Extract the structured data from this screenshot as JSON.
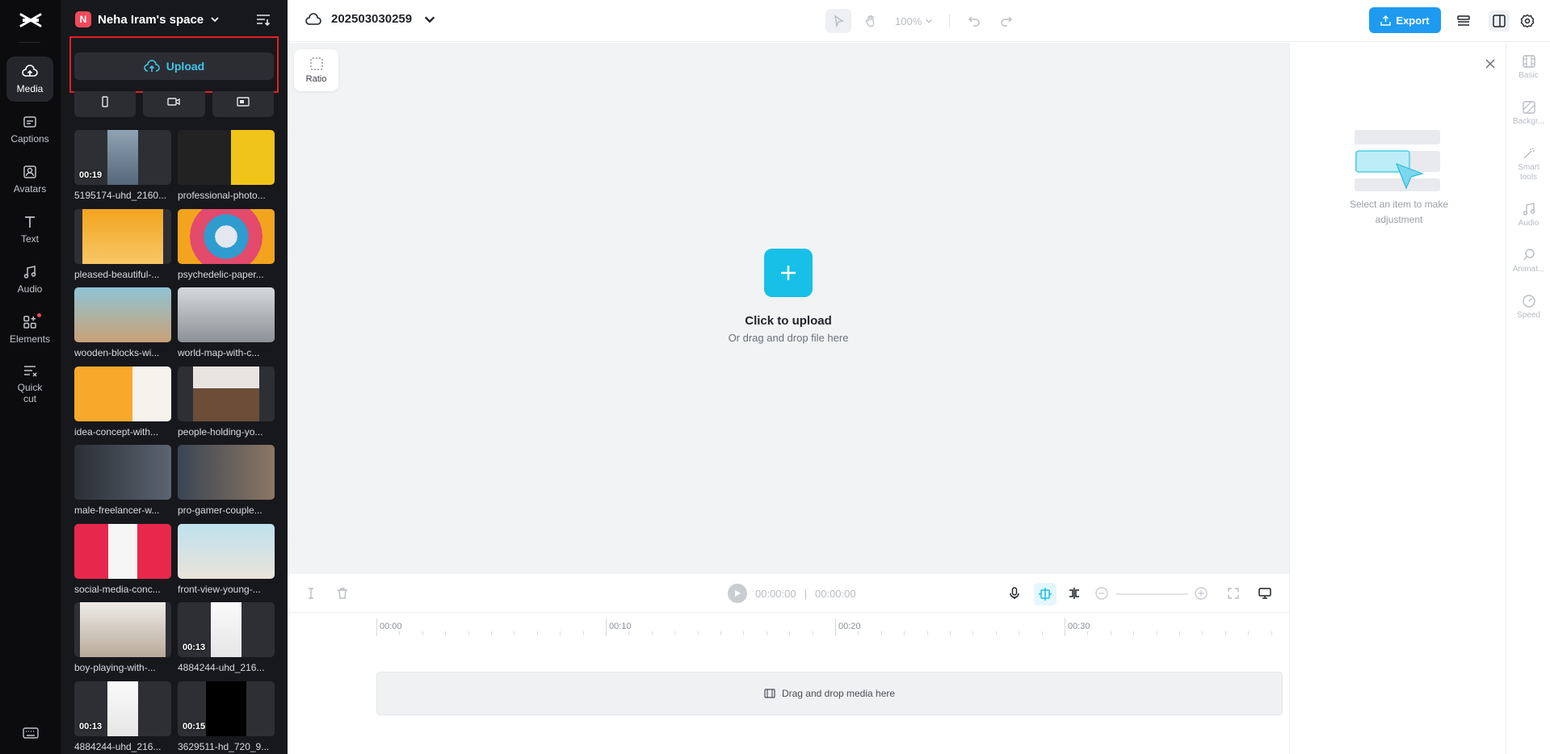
{
  "nav": {
    "items": [
      {
        "label": "Media",
        "icon": "cloud-upload-icon",
        "active": true
      },
      {
        "label": "Captions",
        "icon": "captions-icon"
      },
      {
        "label": "Avatars",
        "icon": "avatar-icon"
      },
      {
        "label": "Text",
        "icon": "text-icon"
      },
      {
        "label": "Audio",
        "icon": "music-note-icon"
      },
      {
        "label": "Elements",
        "icon": "elements-icon",
        "has_dot": true
      },
      {
        "label": "Quick cut",
        "icon": "scissors-icon"
      }
    ]
  },
  "workspace": {
    "initial": "N",
    "name": "Neha Iram's space"
  },
  "media": {
    "upload_label": "Upload",
    "items": [
      {
        "name": "5195174-uhd_2160...",
        "duration": "00:19"
      },
      {
        "name": "professional-photo...",
        "duration": ""
      },
      {
        "name": "pleased-beautiful-...",
        "duration": ""
      },
      {
        "name": "psychedelic-paper...",
        "duration": ""
      },
      {
        "name": "wooden-blocks-wi...",
        "duration": ""
      },
      {
        "name": "world-map-with-c...",
        "duration": ""
      },
      {
        "name": "idea-concept-with...",
        "duration": ""
      },
      {
        "name": "people-holding-yo...",
        "duration": ""
      },
      {
        "name": "male-freelancer-w...",
        "duration": ""
      },
      {
        "name": "pro-gamer-couple...",
        "duration": ""
      },
      {
        "name": "social-media-conc...",
        "duration": ""
      },
      {
        "name": "front-view-young-...",
        "duration": ""
      },
      {
        "name": "boy-playing-with-...",
        "duration": ""
      },
      {
        "name": "4884244-uhd_216...",
        "duration": "00:13"
      },
      {
        "name": "4884244-uhd_216...",
        "duration": "00:13"
      },
      {
        "name": "3629511-hd_720_9...",
        "duration": "00:15"
      }
    ]
  },
  "project": {
    "name": "202503030259"
  },
  "toolbar": {
    "zoom": "100%",
    "export_label": "Export"
  },
  "canvas": {
    "ratio_label": "Ratio",
    "upload_title": "Click to upload",
    "upload_subtitle": "Or drag and drop file here"
  },
  "inspector": {
    "hint": "Select an item to make adjustment",
    "tabs": [
      {
        "label": "Basic"
      },
      {
        "label": "Backgr..."
      },
      {
        "label": "Smart tools"
      },
      {
        "label": "Audio"
      },
      {
        "label": "Animat..."
      },
      {
        "label": "Speed"
      }
    ]
  },
  "timeline": {
    "current_time": "00:00:00",
    "total_time": "00:00:00",
    "separator": "|",
    "ruler": [
      "00:00",
      "00:10",
      "00:20",
      "00:30"
    ],
    "drop_hint": "Drag and drop media here"
  },
  "colors": {
    "accent": "#17c0e6",
    "export": "#1e9bf0",
    "highlight": "#e0202a"
  }
}
